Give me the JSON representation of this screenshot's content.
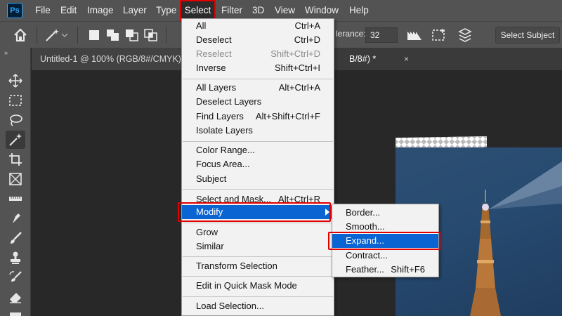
{
  "app": {
    "logo_text": "Ps"
  },
  "menubar": {
    "items": [
      "File",
      "Edit",
      "Image",
      "Layer",
      "Type",
      "Select",
      "Filter",
      "3D",
      "View",
      "Window",
      "Help"
    ],
    "active": "Select"
  },
  "options_bar": {
    "tolerance_label": "lerance:",
    "tolerance_value": "32",
    "select_subject_label": "Select Subject"
  },
  "tabs": [
    {
      "label": "Untitled-1 @ 100% (RGB/8#/CMYK)",
      "active": false
    },
    {
      "label": "B/8#) *",
      "active": true,
      "close": "×"
    }
  ],
  "select_menu": {
    "groups": [
      [
        {
          "label": "All",
          "shortcut": "Ctrl+A",
          "disabled": false
        },
        {
          "label": "Deselect",
          "shortcut": "Ctrl+D",
          "disabled": false
        },
        {
          "label": "Reselect",
          "shortcut": "Shift+Ctrl+D",
          "disabled": true
        },
        {
          "label": "Inverse",
          "shortcut": "Shift+Ctrl+I",
          "disabled": false
        }
      ],
      [
        {
          "label": "All Layers",
          "shortcut": "Alt+Ctrl+A",
          "disabled": false
        },
        {
          "label": "Deselect Layers",
          "shortcut": "",
          "disabled": false
        },
        {
          "label": "Find Layers",
          "shortcut": "Alt+Shift+Ctrl+F",
          "disabled": false
        },
        {
          "label": "Isolate Layers",
          "shortcut": "",
          "disabled": false
        }
      ],
      [
        {
          "label": "Color Range...",
          "shortcut": "",
          "disabled": false
        },
        {
          "label": "Focus Area...",
          "shortcut": "",
          "disabled": false
        },
        {
          "label": "Subject",
          "shortcut": "",
          "disabled": false
        }
      ],
      [
        {
          "label": "Select and Mask...",
          "shortcut": "Alt+Ctrl+R",
          "disabled": false
        },
        {
          "label": "Modify",
          "shortcut": "",
          "disabled": false,
          "highlighted": true,
          "submenu": true
        }
      ],
      [
        {
          "label": "Grow",
          "shortcut": "",
          "disabled": false
        },
        {
          "label": "Similar",
          "shortcut": "",
          "disabled": false
        }
      ],
      [
        {
          "label": "Transform Selection",
          "shortcut": "",
          "disabled": false
        }
      ],
      [
        {
          "label": "Edit in Quick Mask Mode",
          "shortcut": "",
          "disabled": false
        }
      ],
      [
        {
          "label": "Load Selection...",
          "shortcut": "",
          "disabled": false
        }
      ]
    ]
  },
  "modify_submenu": {
    "items": [
      {
        "label": "Border...",
        "shortcut": ""
      },
      {
        "label": "Smooth...",
        "shortcut": ""
      },
      {
        "label": "Expand...",
        "shortcut": "",
        "highlighted": true
      },
      {
        "label": "Contract...",
        "shortcut": ""
      },
      {
        "label": "Feather...",
        "shortcut": "Shift+F6"
      }
    ]
  },
  "colors": {
    "menu_bg": "#535353",
    "highlight": "#0a64d2",
    "annotation_red": "#e00000",
    "sky": "#274a70"
  },
  "icons": {
    "tools": [
      "move-icon",
      "marquee-icon",
      "lasso-icon",
      "magic-wand-icon",
      "crop-icon",
      "frame-icon",
      "ruler-icon",
      "healing-icon",
      "brush-icon",
      "stamp-icon",
      "eraser-icon"
    ]
  }
}
